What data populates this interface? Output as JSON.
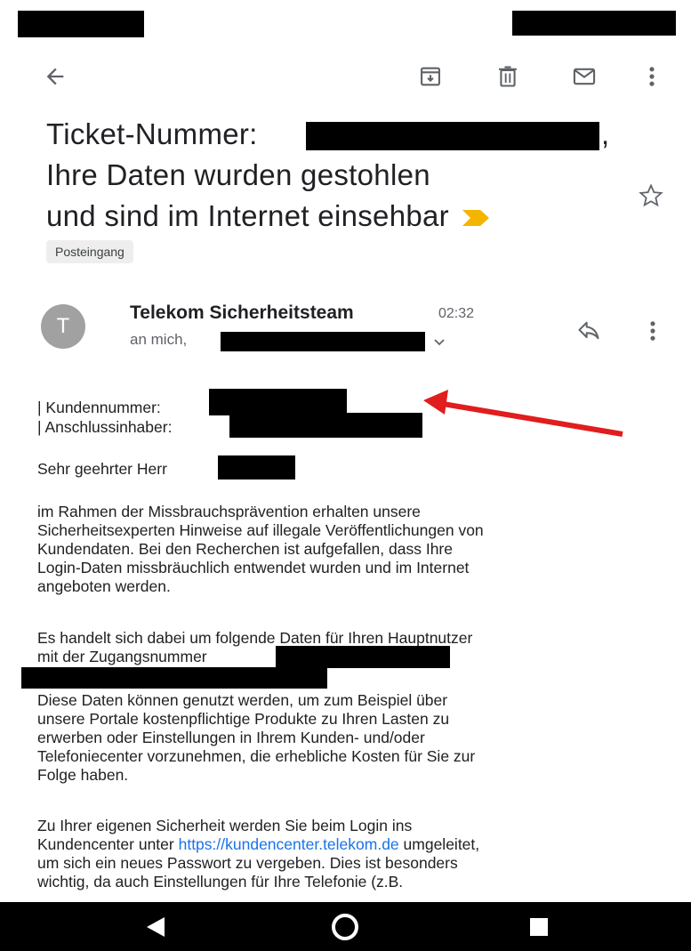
{
  "toolbar": {
    "back_icon": "arrow-left-icon",
    "archive_icon": "archive-icon",
    "delete_icon": "trash-icon",
    "mail_icon": "mail-icon",
    "more_icon": "more-vert-icon"
  },
  "email": {
    "subject_line1": "Ticket-Nummer:",
    "subject_comma": ",",
    "subject_line2": "Ihre Daten wurden gestohlen",
    "subject_line3": "und sind im Internet einsehbar",
    "label": "Posteingang",
    "avatar_letter": "T",
    "sender": "Telekom Sicherheitsteam",
    "time": "02:32",
    "recipient_prefix": "an mich,"
  },
  "body": {
    "customer_number_label": "| Kundennummer:",
    "connection_owner_label": "| Anschlussinhaber:",
    "greeting": "Sehr geehrter Herr",
    "p1_line1": "im Rahmen der Missbrauchsprävention erhalten unsere",
    "p1_line2": "Sicherheitsexperten Hinweise auf illegale Veröffentlichungen von",
    "p1_line3": "Kundendaten. Bei den Recherchen ist aufgefallen, dass Ihre",
    "p1_line4": "Login-Daten missbräuchlich entwendet wurden und im Internet",
    "p1_line5": "angeboten werden.",
    "p2_line1": "Es handelt sich dabei um folgende Daten für Ihren Hauptnutzer",
    "p2_line2": "mit der Zugangsnummer",
    "p3_line1": "Diese Daten können genutzt werden, um zum Beispiel über",
    "p3_line2": "unsere Portale kostenpflichtige Produkte zu Ihren Lasten zu",
    "p3_line3": "erwerben oder Einstellungen in Ihrem Kunden- und/oder",
    "p3_line4": "Telefoniecenter vorzunehmen, die erhebliche Kosten für Sie zur",
    "p3_line5": "Folge haben.",
    "p4_line1": "Zu Ihrer eigenen Sicherheit werden Sie beim Login ins",
    "p4_line2_pre": "Kundencenter unter ",
    "p4_link": "https://kundencenter.telekom.de",
    "p4_line2_post": " umgeleitet,",
    "p4_line3": "um sich ein neues Passwort zu vergeben. Dies ist besonders",
    "p4_line4": "wichtig, da auch Einstellungen für Ihre Telefonie (z.B."
  },
  "colors": {
    "annotation_arrow": "#e11d1d",
    "importance_marker": "#f4b400",
    "link": "#1a73e8"
  },
  "navigation_bar": {
    "back_icon": "nav-back-triangle-icon",
    "home_icon": "nav-home-circle-icon",
    "recents_icon": "nav-recents-square-icon"
  }
}
